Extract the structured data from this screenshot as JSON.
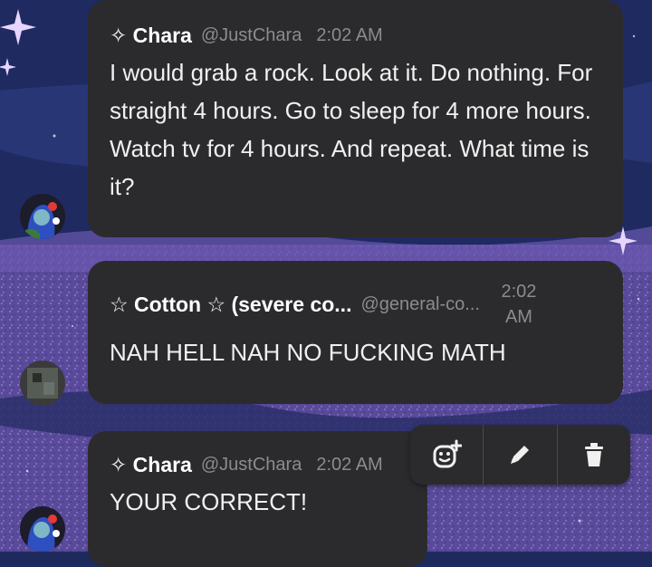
{
  "colors": {
    "bubble": "#2b2b2d",
    "text": "#f0f0f0",
    "muted": "#8b8b90",
    "background": "#1e2a5e"
  },
  "messages": [
    {
      "author": "✧ Chara",
      "handle": "@JustChara",
      "time": "2:02 AM",
      "text": "I would grab a rock. Look at it. Do nothing. For straight 4 hours. Go to sleep for 4 more hours. Watch tv for 4 hours. And repeat. What time is it?"
    },
    {
      "author": "☆ Cotton ☆ (severe co...",
      "handle": "@general-co...",
      "time": "2:02 AM",
      "text": "NAH HELL NAH NO FUCKING MATH"
    },
    {
      "author": "✧ Chara",
      "handle": "@JustChara",
      "time": "2:02 AM",
      "text": "YOUR CORRECT!"
    }
  ],
  "actions": {
    "add_reaction_icon": "add-reaction-icon",
    "edit_icon": "pencil-icon",
    "delete_icon": "trash-icon"
  }
}
